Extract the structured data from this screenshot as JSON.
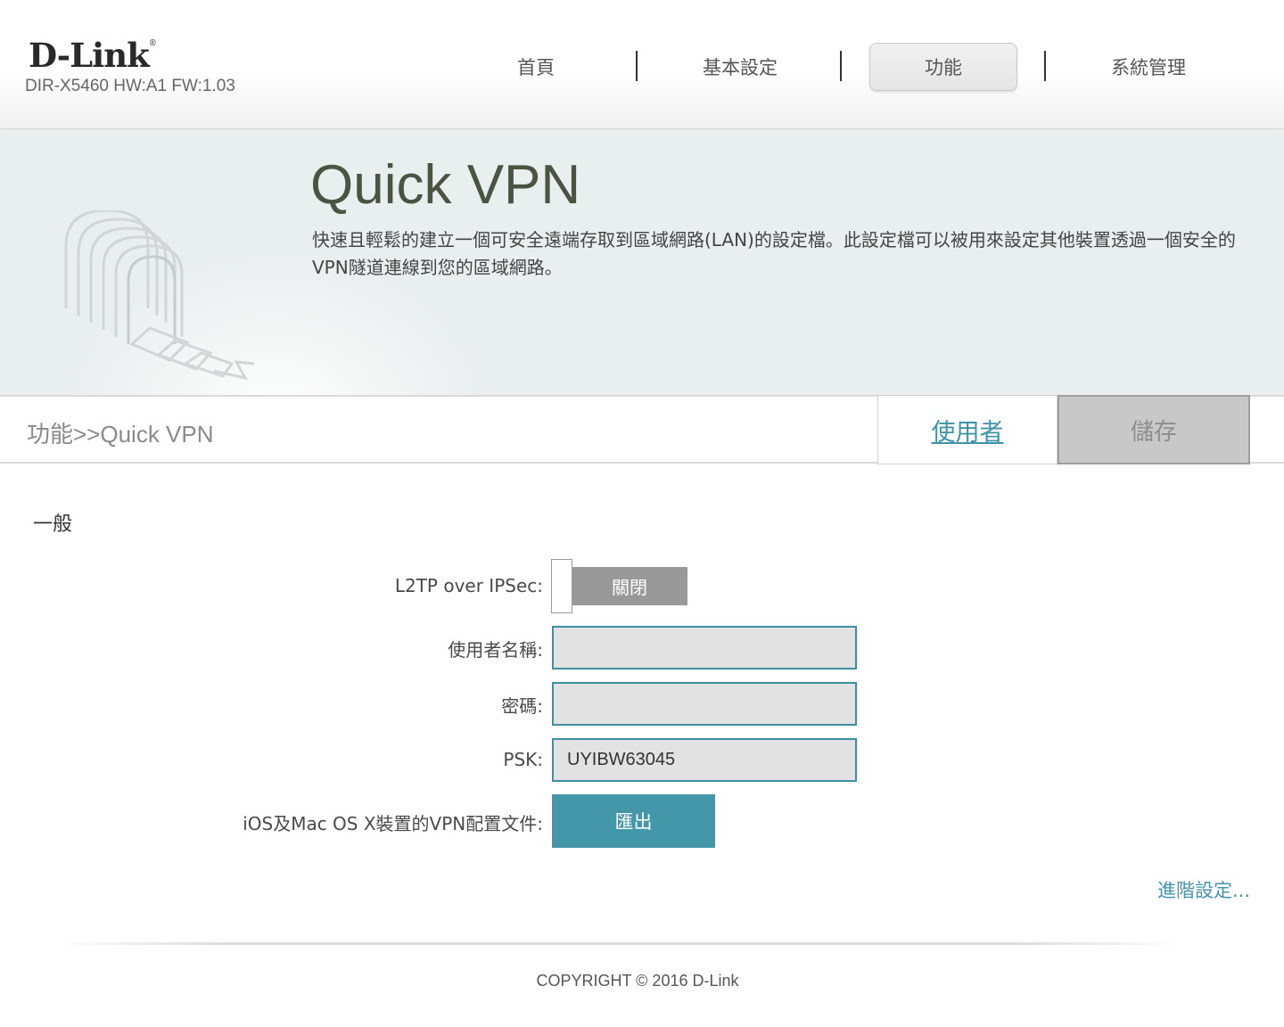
{
  "header": {
    "logo": "D-Link",
    "logo_mark": "®",
    "model": "DIR-X5460 HW:A1 FW:1.03",
    "nav": [
      {
        "label": "首頁",
        "active": false
      },
      {
        "label": "基本設定",
        "active": false
      },
      {
        "label": "功能",
        "active": true
      },
      {
        "label": "系統管理",
        "active": false
      }
    ]
  },
  "banner": {
    "title": "Quick VPN",
    "description": "快速且輕鬆的建立一個可安全遠端存取到區域網路(LAN)的設定檔。此設定檔可以被用來設定其他裝置透過一個安全的VPN隧道連線到您的區域網路。",
    "illustration": "vpn-tunnel-icon"
  },
  "subbar": {
    "breadcrumb": "功能>>Quick VPN",
    "user_link": "使用者",
    "save_label": "儲存"
  },
  "section": {
    "title": "一般"
  },
  "form": {
    "l2tp_label": "L2TP over IPSec:",
    "l2tp_state": "關閉",
    "username_label": "使用者名稱:",
    "username_value": "",
    "password_label": "密碼:",
    "password_value": "",
    "psk_label": "PSK:",
    "psk_value": "UYIBW63045",
    "profile_label": "iOS及Mac OS X裝置的VPN配置文件:",
    "export_label": "匯出"
  },
  "advanced_link": "進階設定...",
  "footer": {
    "copyright": "COPYRIGHT © 2016 D-Link"
  },
  "colors": {
    "accent": "#4397a9",
    "field_border": "#3f8fa1",
    "toggle_off": "#999999",
    "save_disabled": "#c8c8c8"
  }
}
